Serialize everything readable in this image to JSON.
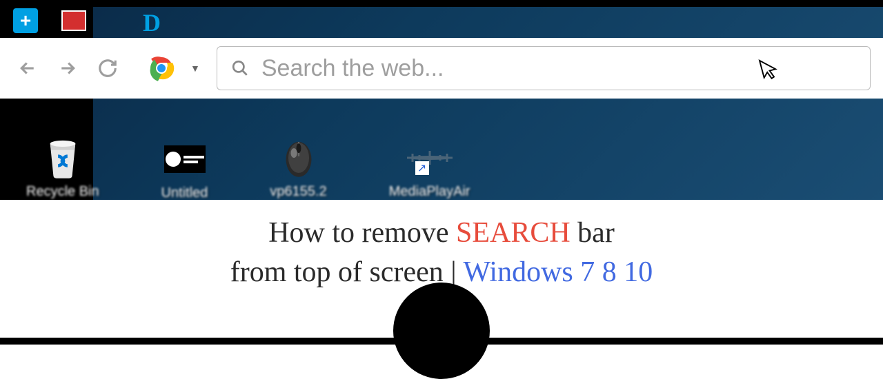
{
  "searchbar": {
    "placeholder": "Search the web..."
  },
  "desktop_icons": {
    "recycle_bin": "Recycle Bin",
    "untitled": "Untitled",
    "vp": "vp6155.2",
    "mediaplay": "MediaPlayAir"
  },
  "title": {
    "line1_prefix": "How to remove ",
    "line1_highlight": "SEARCH",
    "line1_suffix": " bar",
    "line2_prefix": "from top of screen | ",
    "line2_highlight": "Windows 7 8 10"
  },
  "colors": {
    "desktop_bg": "#0d3a5c",
    "title_red": "#e74c3c",
    "title_blue": "#4169e1"
  }
}
